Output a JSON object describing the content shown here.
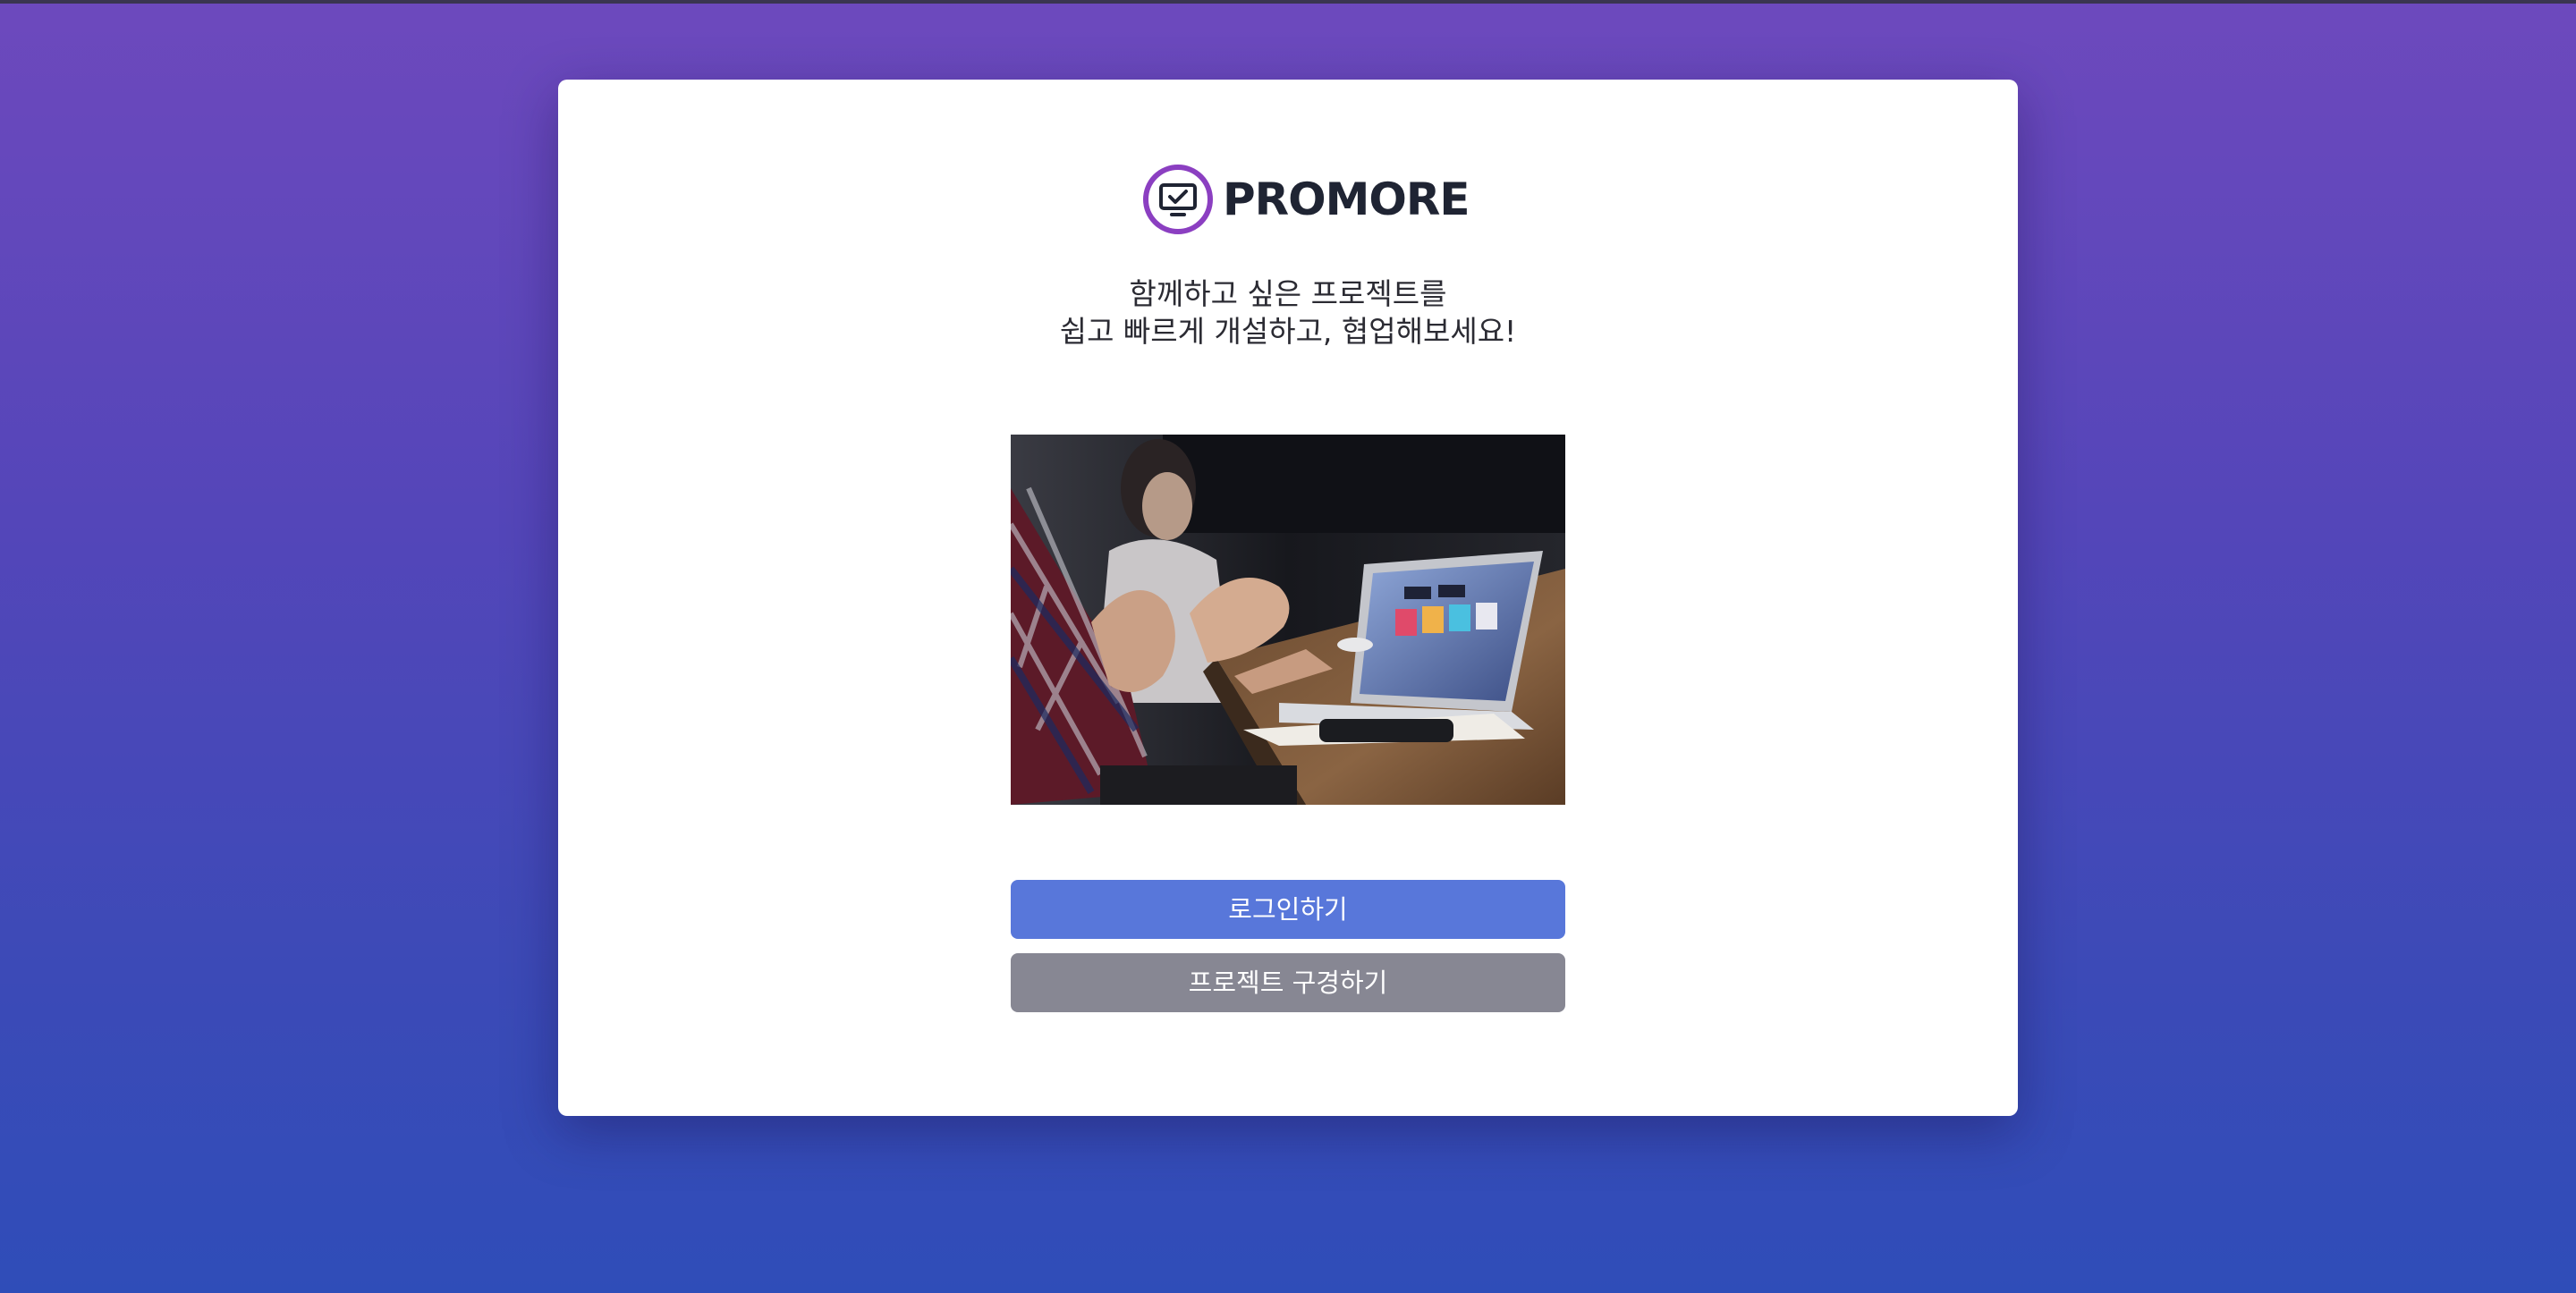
{
  "brand": {
    "name": "PROMORE",
    "logo_icon": "monitor-check-icon",
    "accent_color": "#8b3fc1"
  },
  "tagline": {
    "line1": "함께하고 싶은 프로젝트를",
    "line2": "쉽고 빠르게 개설하고, 협업해보세요!"
  },
  "hero_image": {
    "subject": "people-meeting-with-laptop-photo"
  },
  "actions": {
    "login_label": "로그인하기",
    "browse_label": "프로젝트 구경하기",
    "login_color": "#5877da",
    "browse_color": "#878793"
  },
  "background": {
    "gradient_top": "#6d49bd",
    "gradient_bottom": "#2f4db8"
  }
}
